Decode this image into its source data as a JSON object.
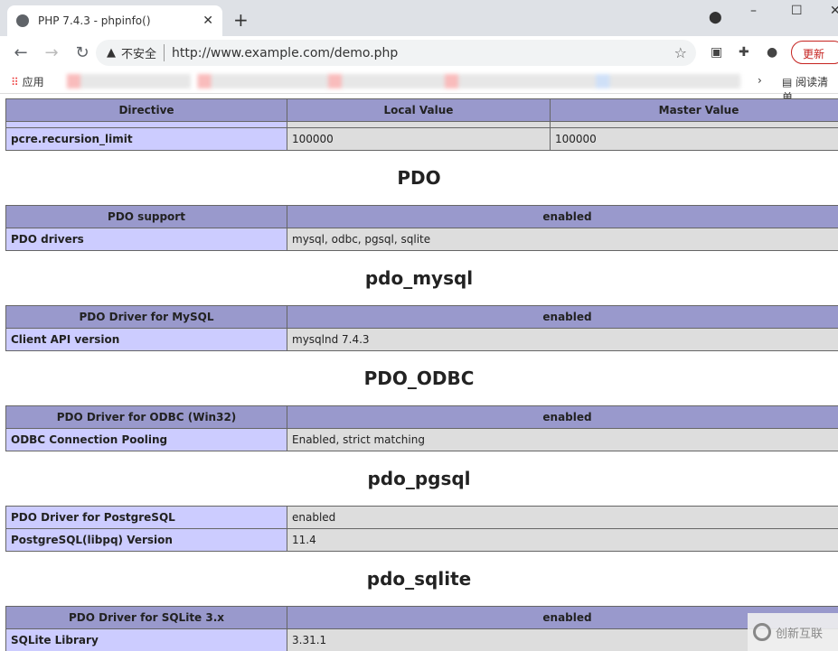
{
  "browser": {
    "tab_title": "PHP 7.4.3 - phpinfo()",
    "insecure_label": "不安全",
    "url": "http://www.example.com/demo.php",
    "update_label": "更新",
    "apps_label": "应用",
    "reading_list": "阅读清单"
  },
  "first_table": {
    "headers": [
      "Directive",
      "Local Value",
      "Master Value"
    ],
    "row": {
      "name": "pcre.recursion_limit",
      "local": "100000",
      "master": "100000"
    }
  },
  "sections": [
    {
      "title": "PDO",
      "rows": [
        {
          "k": "PDO support",
          "v": "enabled",
          "header": true
        },
        {
          "k": "PDO drivers",
          "v": "mysql, odbc, pgsql, sqlite"
        }
      ]
    },
    {
      "title": "pdo_mysql",
      "rows": [
        {
          "k": "PDO Driver for MySQL",
          "v": "enabled",
          "header": true
        },
        {
          "k": "Client API version",
          "v": "mysqlnd 7.4.3"
        }
      ]
    },
    {
      "title": "PDO_ODBC",
      "rows": [
        {
          "k": "PDO Driver for ODBC (Win32)",
          "v": "enabled",
          "header": true
        },
        {
          "k": "ODBC Connection Pooling",
          "v": "Enabled, strict matching"
        }
      ]
    },
    {
      "title": "pdo_pgsql",
      "rows": [
        {
          "k": "PDO Driver for PostgreSQL",
          "v": "enabled"
        },
        {
          "k": "PostgreSQL(libpq) Version",
          "v": "11.4"
        }
      ]
    },
    {
      "title": "pdo_sqlite",
      "rows": [
        {
          "k": "PDO Driver for SQLite 3.x",
          "v": "enabled",
          "header": true
        },
        {
          "k": "SQLite Library",
          "v": "3.31.1"
        }
      ]
    }
  ],
  "watermark": "创新互联"
}
